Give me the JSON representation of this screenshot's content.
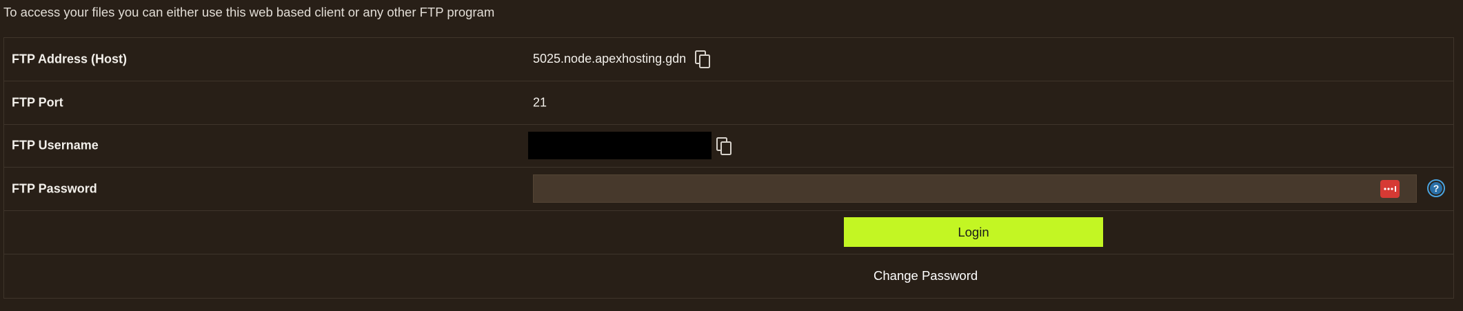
{
  "intro_text": "To access your files you can either use this web based client or any other FTP program",
  "rows": {
    "address": {
      "label": "FTP Address (Host)",
      "value": "5025.node.apexhosting.gdn"
    },
    "port": {
      "label": "FTP Port",
      "value": "21"
    },
    "username": {
      "label": "FTP Username",
      "value": ""
    },
    "password": {
      "label": "FTP Password",
      "value": "",
      "placeholder": ""
    }
  },
  "actions": {
    "login_label": "Login",
    "change_password_label": "Change Password"
  },
  "icons": {
    "copy": "copy-icon",
    "password_manager": "password-manager-icon",
    "help": "help-icon"
  },
  "colors": {
    "background": "#281f17",
    "row_border": "#3f352b",
    "input_bg": "#47392c",
    "login_button": "#c3f623",
    "help_accent": "#4aa3df",
    "pw_manager_red": "#d63a34"
  }
}
